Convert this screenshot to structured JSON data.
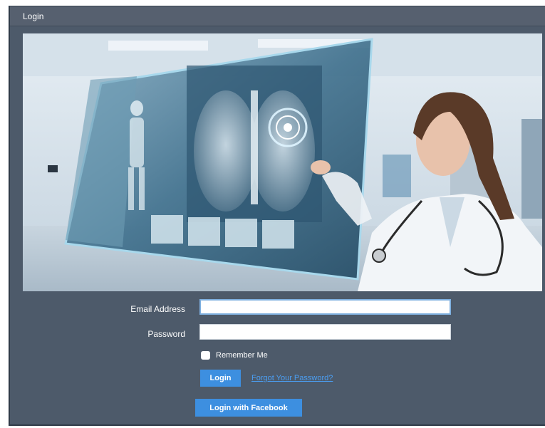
{
  "header": {
    "title": "Login"
  },
  "hero": {
    "image": "doctor-xray-hologram-illustration"
  },
  "form": {
    "email_label": "Email Address",
    "email_value": "",
    "password_label": "Password",
    "password_value": "",
    "remember_label": "Remember Me",
    "remember_checked": false,
    "login_label": "Login",
    "forgot_label": "Forgot Your Password?",
    "facebook_label": "Login with Facebook"
  },
  "colors": {
    "panel": "#4d5a6a",
    "header": "#56606f",
    "button": "#3d8fe0",
    "link": "#4b9ef2"
  }
}
